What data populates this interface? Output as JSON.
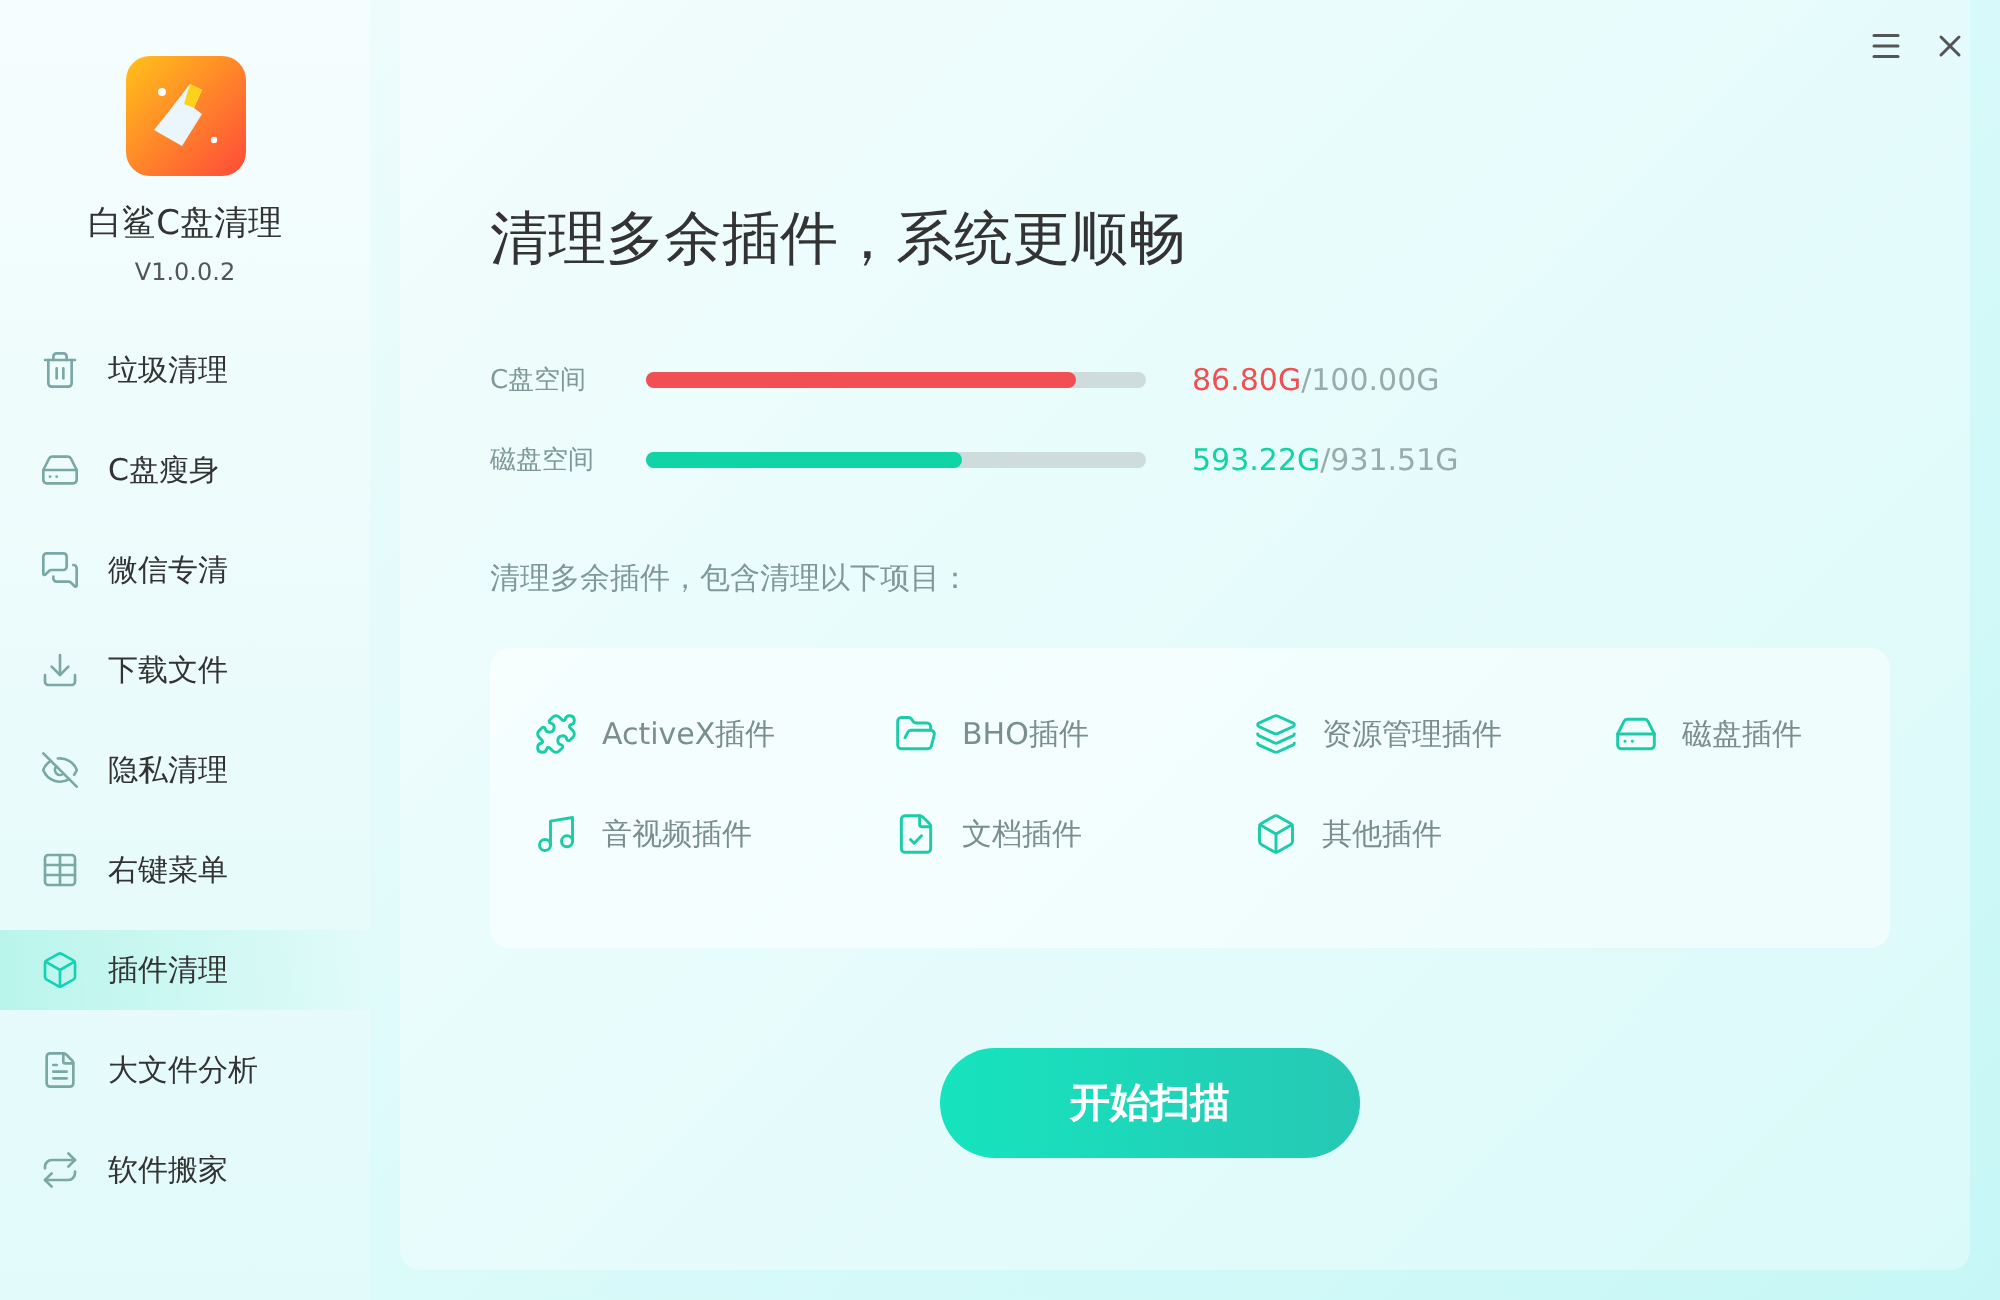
{
  "app": {
    "name": "白鲨C盘清理",
    "version": "V1.0.0.2"
  },
  "sidebar": {
    "items": [
      {
        "label": "垃圾清理",
        "selected": false
      },
      {
        "label": "C盘瘦身",
        "selected": false
      },
      {
        "label": "微信专清",
        "selected": false
      },
      {
        "label": "下载文件",
        "selected": false
      },
      {
        "label": "隐私清理",
        "selected": false
      },
      {
        "label": "右键菜单",
        "selected": false
      },
      {
        "label": "插件清理",
        "selected": true
      },
      {
        "label": "大文件分析",
        "selected": false
      },
      {
        "label": "软件搬家",
        "selected": false
      }
    ]
  },
  "title": "清理多余插件，系统更顺畅",
  "usage": [
    {
      "label": "C盘空间",
      "level": 0.86,
      "used": "86.80G",
      "total": "/100.00G",
      "color": "#f24f52"
    },
    {
      "label": "磁盘空间",
      "level": 0.63,
      "used": "593.22G",
      "total": "/931.51G",
      "color": "#10d3a6"
    }
  ],
  "description": "清理多余插件，包含清理以下项目：",
  "plugins": [
    "ActiveX插件",
    "BHO插件",
    "资源管理插件",
    "磁盘插件",
    "音视频插件",
    "文档插件",
    "其他插件"
  ],
  "scan_button": "开始扫描"
}
